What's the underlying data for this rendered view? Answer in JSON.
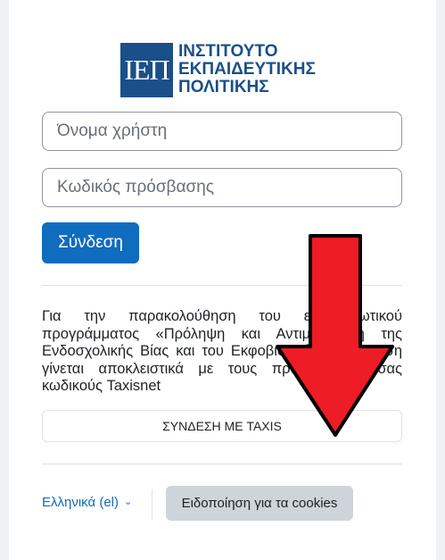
{
  "logo": {
    "mark": "ΙΕΠ",
    "lines": [
      "ΙΝΣΤΙΤΟΥΤΟ",
      "ΕΚΠΑΙΔΕΥΤΙΚΗΣ",
      "ΠΟΛΙΤΙΚΗΣ"
    ]
  },
  "login": {
    "username_placeholder": "Όνομα χρήστη",
    "password_placeholder": "Κωδικός πρόσβασης",
    "submit_label": "Σύνδεση"
  },
  "info_text": "Για την παρακολούθηση του επιμορφωτικού προγράμματος «Πρόληψη και Αντιμετώπιση της Ενδοσχολικής Βίας και του Εκφοβισμού», η σύνδεση γίνεται αποκλειστικά με τους προσωπικούς σας κωδικούς Taxisnet",
  "taxis_button_label": "ΣΥΝΔΕΣΗ ΜΕ TAXIS",
  "footer": {
    "language_label": "Ελληνικά (el)",
    "cookies_button_label": "Ειδοποίηση για τα cookies"
  },
  "colors": {
    "primary": "#0f6cbf",
    "logo_blue": "#1a4f8a",
    "arrow_red": "#ee1c25"
  },
  "icons": {
    "language_chevron": "chevron-down-icon",
    "overlay_arrow": "arrow-down-icon"
  }
}
